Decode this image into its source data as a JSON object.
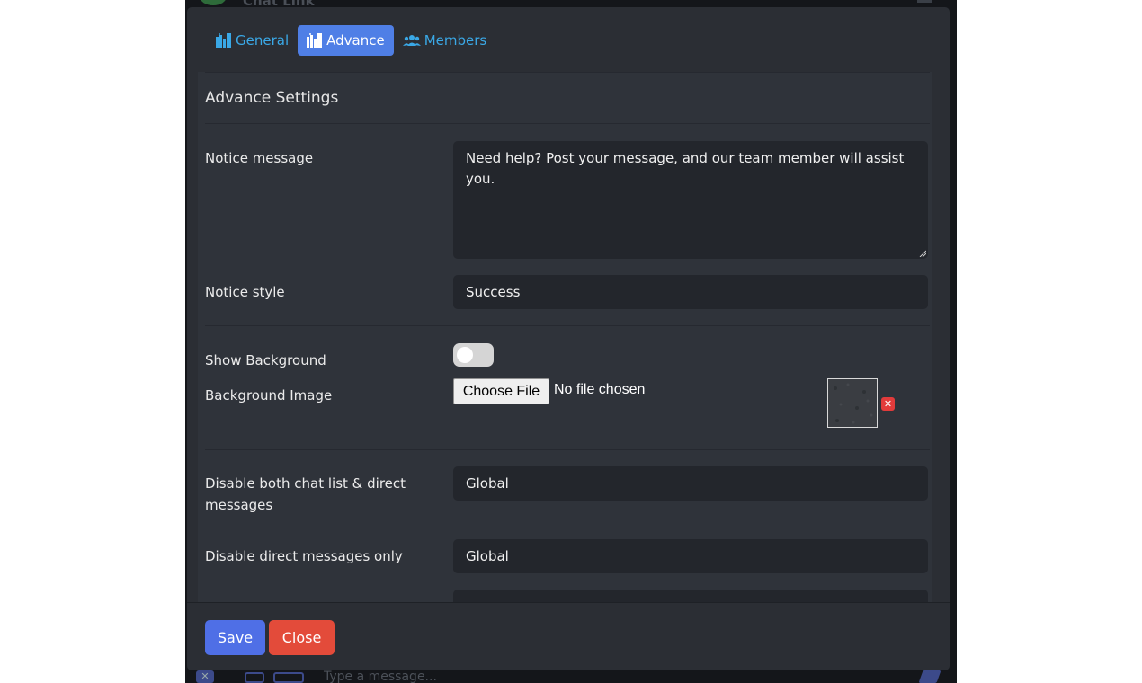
{
  "background": {
    "title": "Chat Link",
    "composer_placeholder": "Type a message..."
  },
  "tabs": [
    {
      "label": "General",
      "icon": "book-shelf-icon",
      "active": false
    },
    {
      "label": "Advance",
      "icon": "book-shelf-icon",
      "active": true
    },
    {
      "label": "Members",
      "icon": "users-icon",
      "active": false
    }
  ],
  "section": {
    "title": "Advance Settings"
  },
  "fields": {
    "notice_message": {
      "label": "Notice message",
      "value": "Need help? Post your message, and our team member will assist you."
    },
    "notice_style": {
      "label": "Notice style",
      "value": "Success"
    },
    "show_background": {
      "label": "Show Background",
      "checked": false
    },
    "background_image": {
      "label": "Background Image",
      "button": "Choose File",
      "status": "No file chosen",
      "remove_icon": "x-icon"
    },
    "disable_both": {
      "label": "Disable both chat list & direct messages",
      "value": "Global"
    },
    "disable_direct": {
      "label": "Disable direct messages only",
      "value": "Global"
    }
  },
  "footer": {
    "save_label": "Save",
    "close_label": "Close"
  },
  "colors": {
    "modal_bg": "#2b2e34",
    "tab_link": "#3aa8e6",
    "tab_active": "#4f7fe6",
    "save": "#4f6fe6",
    "close": "#e34b3a"
  }
}
